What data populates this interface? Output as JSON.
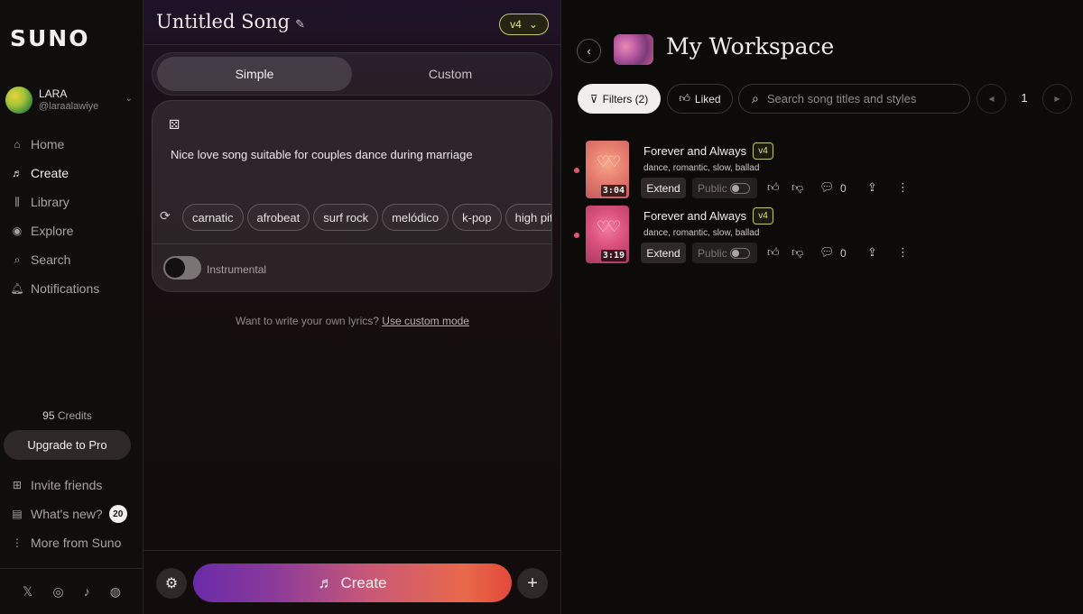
{
  "sidebar": {
    "logo": "SUNO",
    "user": {
      "name": "LARA",
      "handle": "@laraalawiye"
    },
    "nav": [
      {
        "label": "Home",
        "icon": "home-icon"
      },
      {
        "label": "Create",
        "icon": "music-note-icon"
      },
      {
        "label": "Library",
        "icon": "library-icon"
      },
      {
        "label": "Explore",
        "icon": "compass-icon"
      },
      {
        "label": "Search",
        "icon": "search-icon"
      },
      {
        "label": "Notifications",
        "icon": "bell-icon"
      }
    ],
    "credits_count": "95",
    "credits_label": "Credits",
    "upgrade_label": "Upgrade to Pro",
    "bottom_nav": [
      {
        "label": "Invite friends",
        "icon": "gift-icon"
      },
      {
        "label": "What's new?",
        "icon": "document-icon",
        "badge": "20"
      },
      {
        "label": "More from Suno",
        "icon": "more-vertical-icon"
      }
    ],
    "social": [
      "x-icon",
      "instagram-icon",
      "tiktok-icon",
      "discord-icon"
    ]
  },
  "create": {
    "song_title": "Untitled Song",
    "version": "v4",
    "mode_simple": "Simple",
    "mode_custom": "Custom",
    "prompt": "Nice love song suitable for couples dance during marriage",
    "tags": [
      "carnatic",
      "afrobeat",
      "surf rock",
      "melódico",
      "k-pop",
      "high pitch"
    ],
    "instrumental_label": "Instrumental",
    "hint_text": "Want to write your own lyrics?",
    "hint_link": "Use custom mode",
    "create_label": "Create"
  },
  "workspace": {
    "title": "My Workspace",
    "filters_label": "Filters (2)",
    "liked_label": "Liked",
    "search_placeholder": "Search song titles and styles",
    "page": "1",
    "songs": [
      {
        "title": "Forever and Always",
        "version": "v4",
        "tags": "dance, romantic, slow, ballad",
        "duration": "3:04",
        "extend_label": "Extend",
        "public_label": "Public",
        "comments": "0"
      },
      {
        "title": "Forever and Always",
        "version": "v4",
        "tags": "dance, romantic, slow, ballad",
        "duration": "3:19",
        "extend_label": "Extend",
        "public_label": "Public",
        "comments": "0"
      }
    ]
  },
  "colors": {
    "accent_version": "#c4c866",
    "create_gradient_start": "#6a2aa8",
    "create_gradient_end": "#e24a3a",
    "unplayed_dot": "#e05870"
  }
}
